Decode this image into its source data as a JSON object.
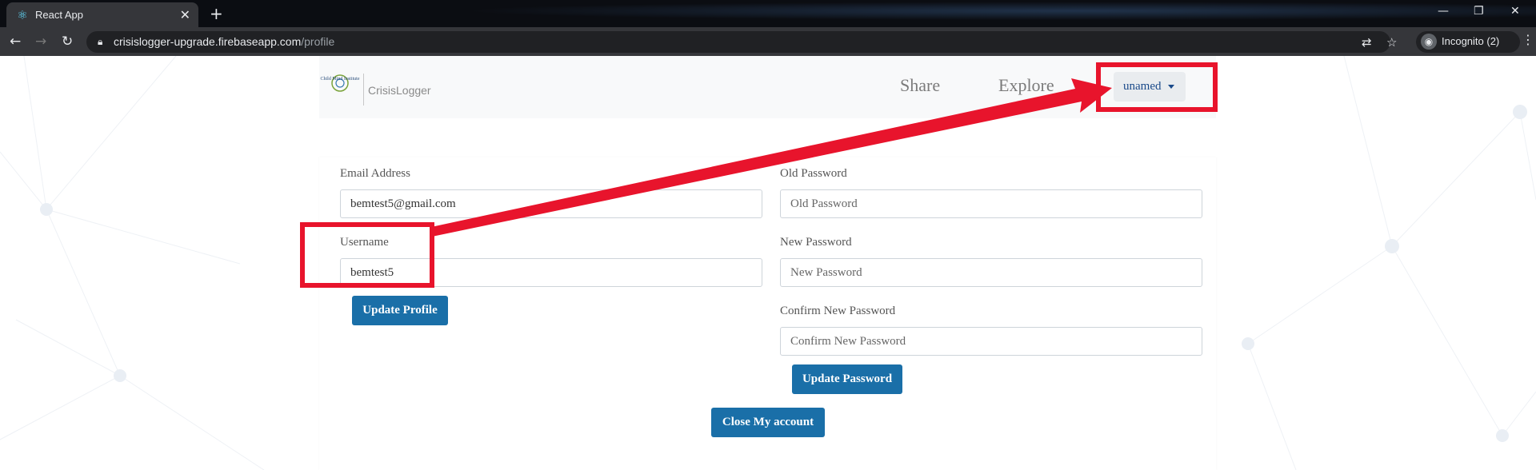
{
  "browser": {
    "tab_title": "React App",
    "url_host": "crisislogger-upgrade.firebaseapp.com",
    "url_path": "/profile",
    "incognito_label": "Incognito (2)"
  },
  "navbar": {
    "logo_text": "Child Mind Institute",
    "brand": "CrisisLogger",
    "links": [
      "Share",
      "Explore"
    ],
    "user_menu": "unamed"
  },
  "profile": {
    "email_label": "Email Address",
    "email_value": "bemtest5@gmail.com",
    "username_label": "Username",
    "username_value": "bemtest5",
    "update_profile": "Update Profile"
  },
  "password": {
    "old_label": "Old Password",
    "old_placeholder": "Old Password",
    "new_label": "New Password",
    "new_placeholder": "New Password",
    "confirm_label": "Confirm New Password",
    "confirm_placeholder": "Confirm New Password",
    "update_password": "Update Password"
  },
  "close_account": "Close My account",
  "colors": {
    "primary_button": "#1a6fa8",
    "annotation": "#e8142c"
  }
}
